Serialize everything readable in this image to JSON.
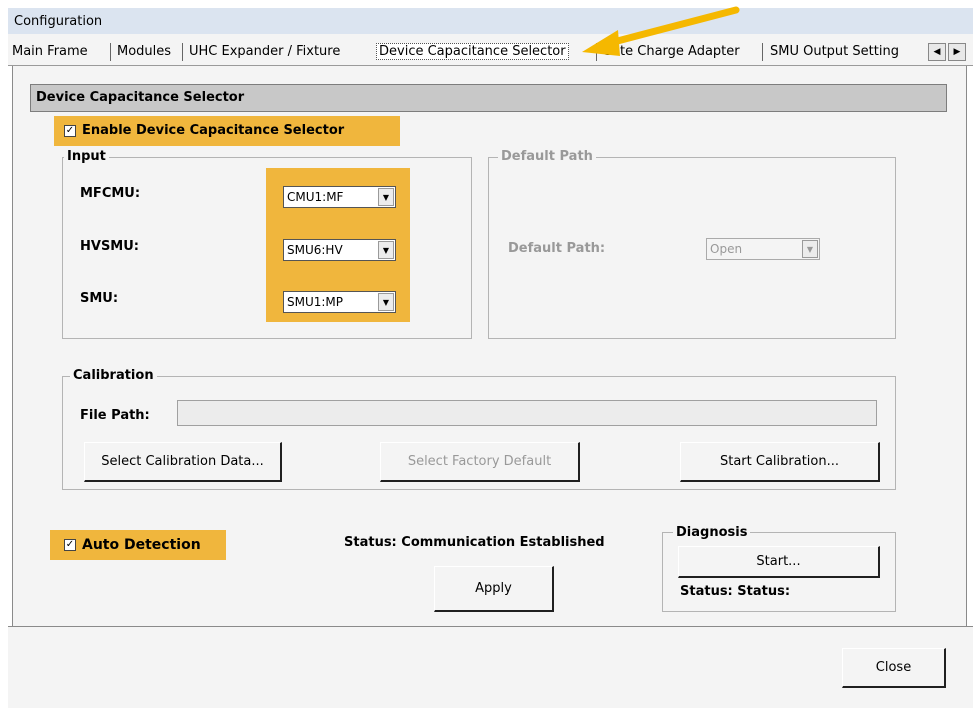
{
  "window": {
    "title": "Configuration"
  },
  "tabs": [
    {
      "label": "Main Frame"
    },
    {
      "label": "Modules"
    },
    {
      "label": "UHC Expander / Fixture"
    },
    {
      "label": "Device Capacitance Selector"
    },
    {
      "label": "Gate Charge Adapter"
    },
    {
      "label": "SMU Output Setting"
    }
  ],
  "panel": {
    "header": "Device Capacitance Selector",
    "enable_checkbox": {
      "label": "Enable Device Capacitance Selector",
      "checked": true
    }
  },
  "input_group": {
    "title": "Input",
    "rows": [
      {
        "label": "MFCMU:",
        "value": "CMU1:MF"
      },
      {
        "label": "HVSMU:",
        "value": "SMU6:HV"
      },
      {
        "label": "SMU:",
        "value": "SMU1:MP"
      }
    ]
  },
  "default_path_group": {
    "title": "Default Path",
    "label": "Default Path:",
    "value": "Open"
  },
  "calibration_group": {
    "title": "Calibration",
    "file_path_label": "File Path:",
    "file_path_value": "",
    "select_data_button": "Select Calibration Data...",
    "factory_default_button": "Select Factory Default",
    "start_button": "Start Calibration..."
  },
  "auto_detection": {
    "label": "Auto Detection",
    "checked": true
  },
  "status_text": "Status: Communication Established",
  "apply_button": "Apply",
  "diagnosis": {
    "title": "Diagnosis",
    "start_button": "Start...",
    "status": "Status: Status:"
  },
  "close_button": "Close",
  "colors": {
    "highlight": "#f0b63d",
    "arrow": "#f5b800"
  }
}
